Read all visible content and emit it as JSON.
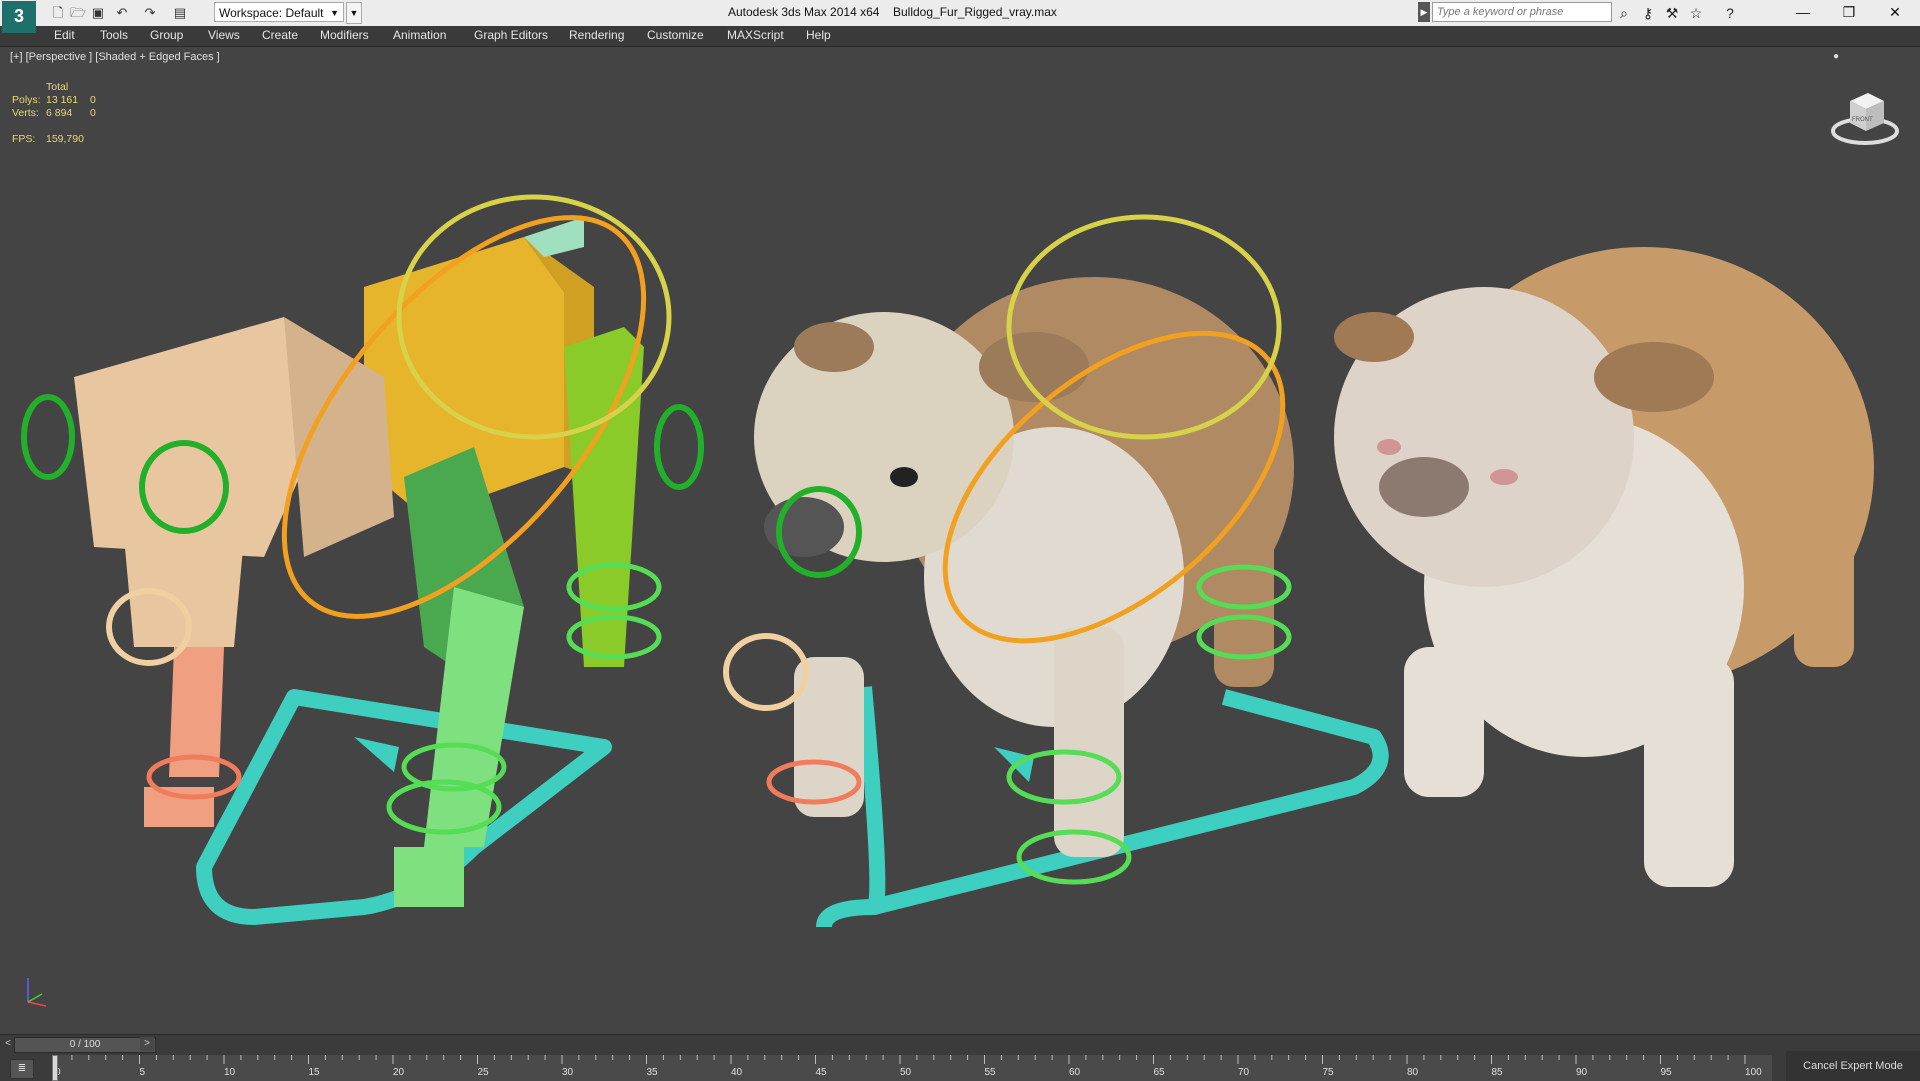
{
  "title_bar": {
    "app_title": "Autodesk 3ds Max  2014 x64",
    "file_name": "Bulldog_Fur_Rigged_vray.max",
    "workspace_label": "Workspace: Default",
    "search_placeholder": "Type a keyword or phrase",
    "quick_access_icons": [
      "new-file-icon",
      "open-file-icon",
      "save-icon",
      "undo-icon",
      "redo-icon",
      "project-folder-icon"
    ],
    "toolbar_icons": [
      "binoculars-icon",
      "key-icon",
      "star-icon",
      "help-icon"
    ],
    "window_controls": [
      "minimize-icon",
      "restore-icon",
      "close-icon"
    ]
  },
  "menu_bar": {
    "items": [
      "Edit",
      "Tools",
      "Group",
      "Views",
      "Create",
      "Modifiers",
      "Animation",
      "Graph Editors",
      "Rendering",
      "Customize",
      "MAXScript",
      "Help"
    ]
  },
  "viewport": {
    "label": "[+] [Perspective ] [Shaded + Edged Faces ]",
    "stats": {
      "total_header": "Total",
      "polys_label": "Polys:",
      "polys_total": "13 161",
      "polys_selected": "0",
      "verts_label": "Verts:",
      "verts_total": "6 894",
      "verts_selected": "0",
      "fps_label": "FPS:",
      "fps_value": "159,790"
    },
    "viewcube_label": "FRONT",
    "stat_color": "#e8d873",
    "background_color": "#444444"
  },
  "timeline": {
    "frame_display": "0 / 100",
    "ticks": [
      "0",
      "5",
      "10",
      "15",
      "20",
      "25",
      "30",
      "35",
      "40",
      "45",
      "50",
      "55",
      "60",
      "65",
      "70",
      "75",
      "80",
      "85",
      "90",
      "95",
      "100"
    ],
    "current_frame": 0,
    "cancel_expert_label": "Cancel Expert Mode"
  }
}
